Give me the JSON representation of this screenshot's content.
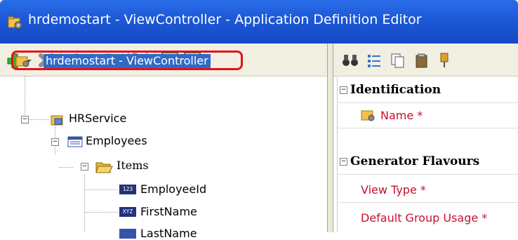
{
  "window": {
    "title": "hrdemostart - ViewController - Application Definition Editor"
  },
  "tree": {
    "root": "hrdemostart - ViewController",
    "service": "HRService",
    "view": "Employees",
    "items_folder": "Items",
    "items": [
      {
        "badge": "123",
        "label": "EmployeeId"
      },
      {
        "badge": "XYZ",
        "label": "FirstName"
      },
      {
        "badge": "",
        "label": "LastName"
      }
    ]
  },
  "properties": {
    "groups": [
      {
        "label": "Identification"
      },
      {
        "label": "Generator Flavours"
      }
    ],
    "rows": [
      {
        "label": "Name *"
      },
      {
        "label": "View Type *"
      },
      {
        "label": "Default Group Usage *"
      }
    ]
  },
  "colors": {
    "titlebar": "#1c58d6",
    "selection": "#316ac5",
    "highlight_border": "#e3121b",
    "required_label": "#c8102e"
  }
}
